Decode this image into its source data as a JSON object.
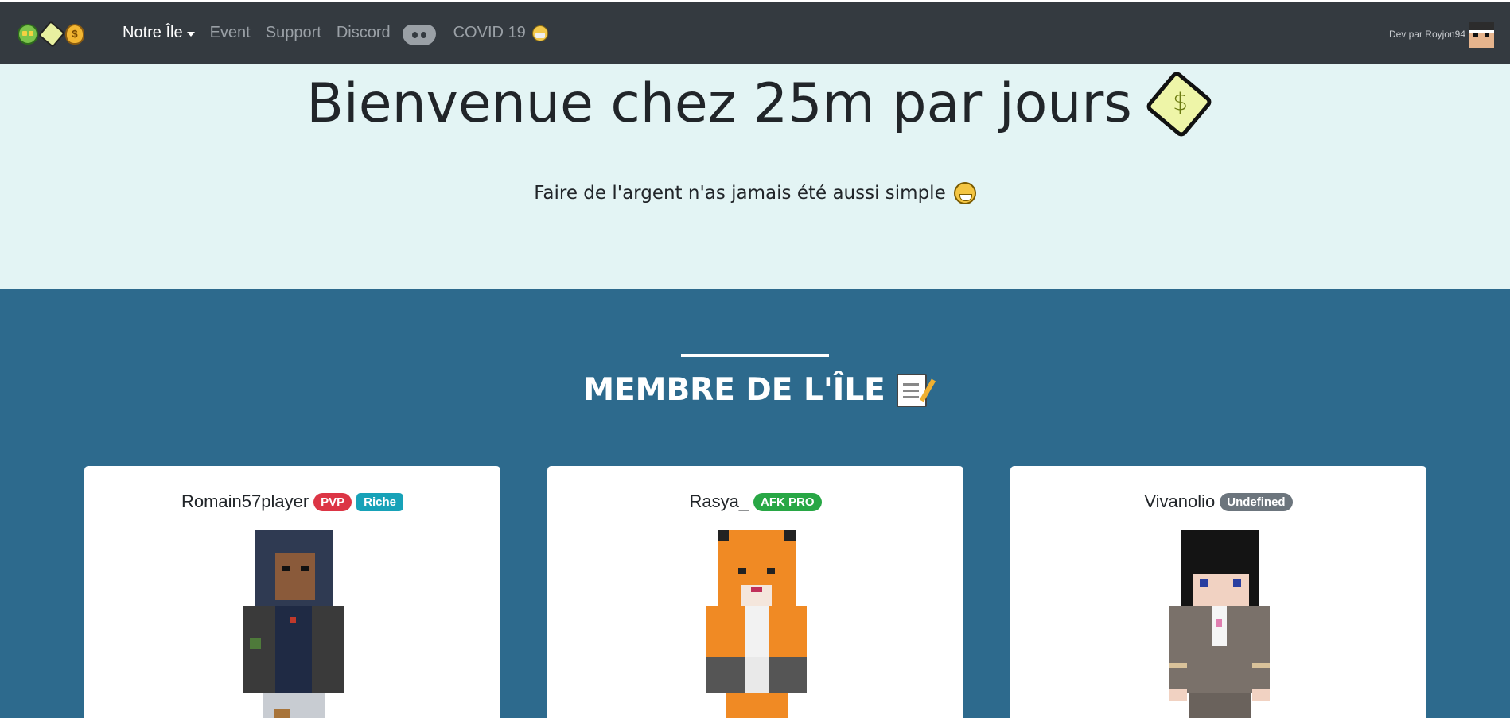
{
  "navbar": {
    "brand_icons": [
      "money-face-icon",
      "money-wings-icon",
      "money-bag-icon"
    ],
    "links": [
      {
        "label": "Notre Île",
        "active": true,
        "dropdown": true
      },
      {
        "label": "Event"
      },
      {
        "label": "Support"
      },
      {
        "label": "Discord"
      },
      {
        "label": "COVID 19"
      }
    ],
    "dev_label": "Dev par Royjon94",
    "background": "#343a40"
  },
  "hero": {
    "title": "Bienvenue chez 25m par jours",
    "subtitle": "Faire de l'argent n'as jamais été aussi simple",
    "background": "#e3f4f4"
  },
  "members": {
    "title": "MEMBRE DE L'ÎLE",
    "background": "#2d6a8d",
    "cards": [
      {
        "name": "Romain57player",
        "badges": [
          {
            "label": "PVP",
            "color": "#dc3545"
          },
          {
            "label": "Riche",
            "color": "#17a2b8"
          }
        ]
      },
      {
        "name": "Rasya_",
        "badges": [
          {
            "label": "AFK PRO",
            "color": "#28a745"
          }
        ]
      },
      {
        "name": "Vivanolio",
        "badges": [
          {
            "label": "Undefined",
            "color": "#6c757d"
          }
        ]
      }
    ]
  }
}
